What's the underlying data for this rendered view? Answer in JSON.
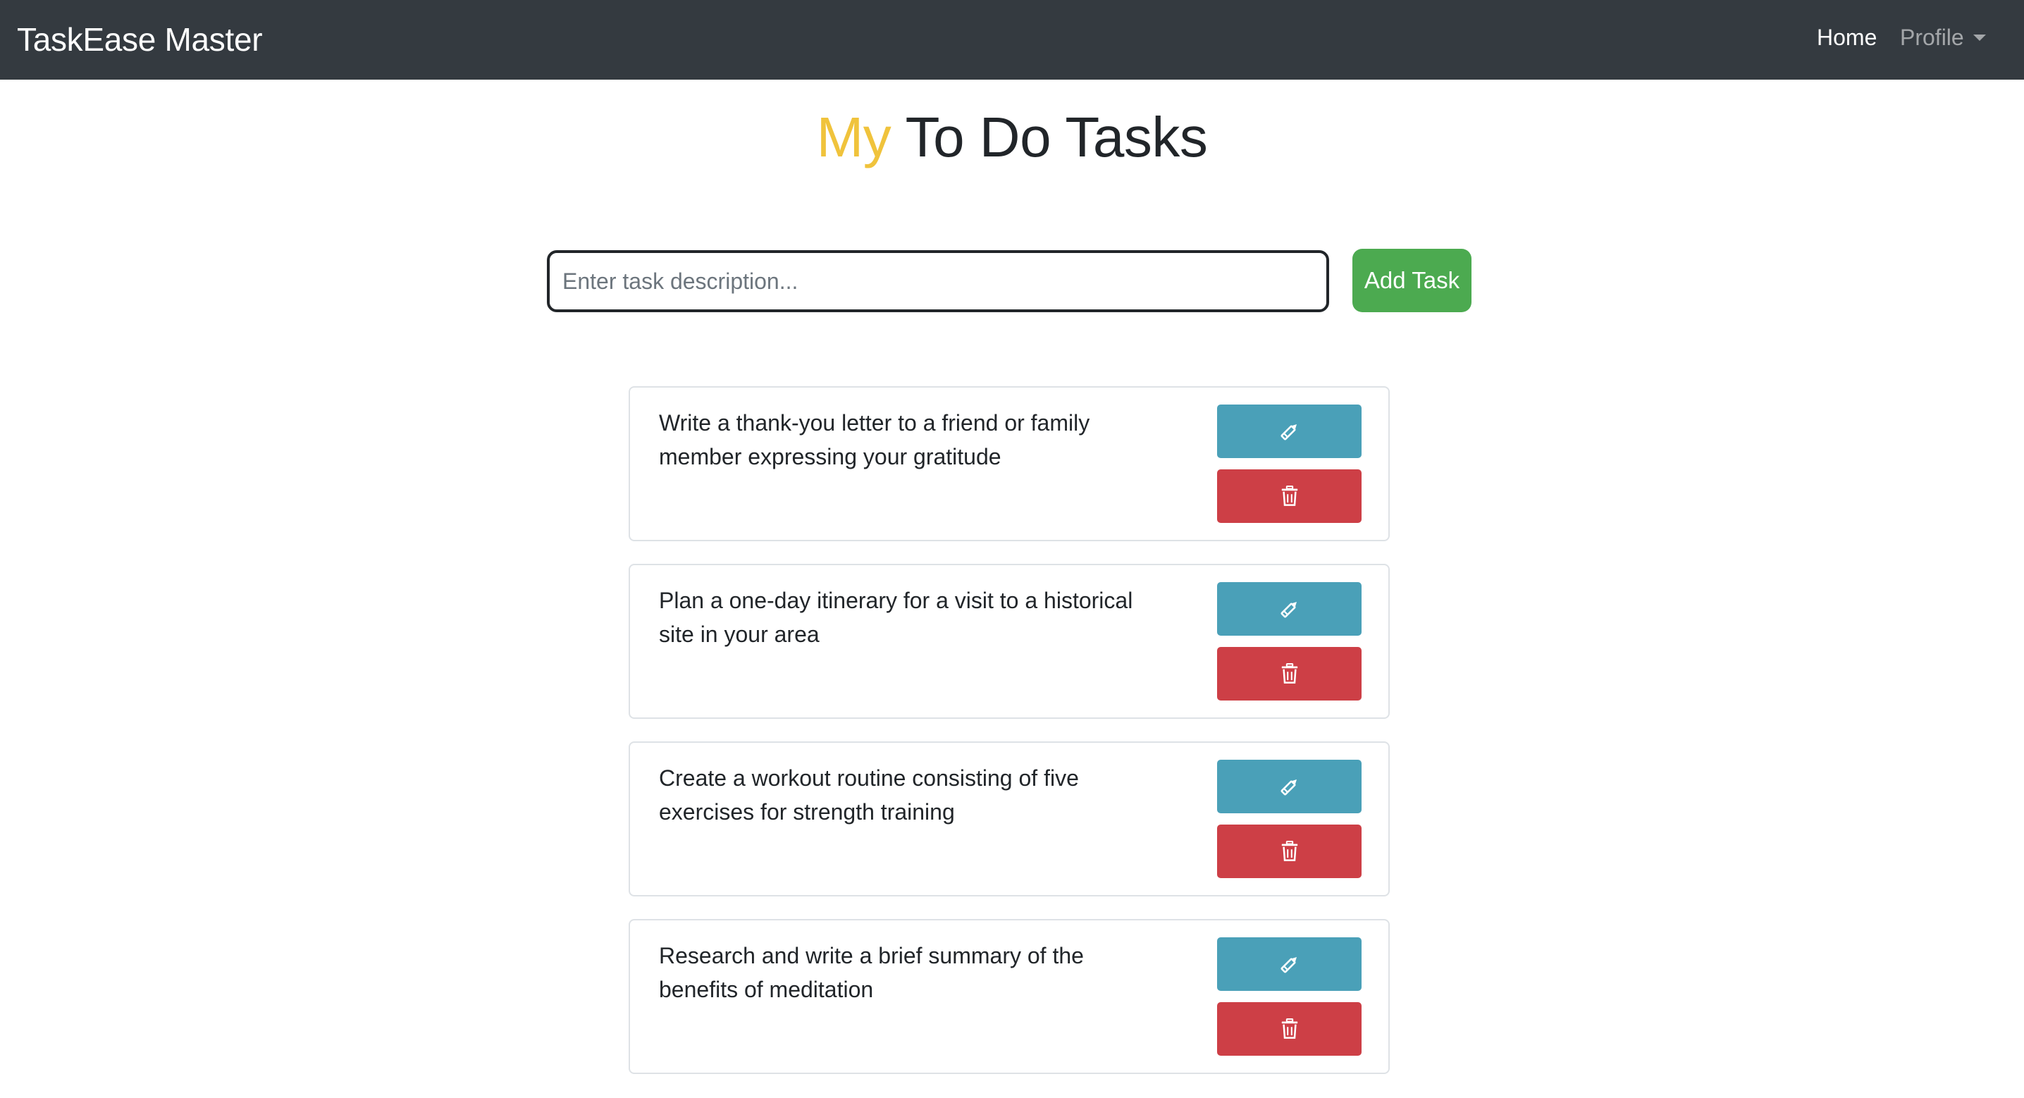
{
  "navbar": {
    "brand": "TaskEase Master",
    "home_label": "Home",
    "profile_label": "Profile"
  },
  "header": {
    "title_accent": "My",
    "title_rest": " To Do Tasks",
    "accent_color": "#f0c33c"
  },
  "form": {
    "input_placeholder": "Enter task description...",
    "input_value": "",
    "add_label": "Add Task"
  },
  "tasks": [
    {
      "text": "Write a thank-you letter to a friend or family member expressing your gratitude",
      "edit_icon": "pencil-icon",
      "delete_icon": "trash-icon"
    },
    {
      "text": "Plan a one-day itinerary for a visit to a historical site in your area",
      "edit_icon": "pencil-icon",
      "delete_icon": "trash-icon"
    },
    {
      "text": "Create a workout routine consisting of five exercises for strength training",
      "edit_icon": "pencil-icon",
      "delete_icon": "trash-icon"
    },
    {
      "text": "Research and write a brief summary of the benefits of meditation",
      "edit_icon": "pencil-icon",
      "delete_icon": "trash-icon"
    }
  ],
  "colors": {
    "navbar_bg": "#343a40",
    "add_button": "#4caa50",
    "edit_button": "#4aa0b8",
    "delete_button": "#cd3f46"
  }
}
